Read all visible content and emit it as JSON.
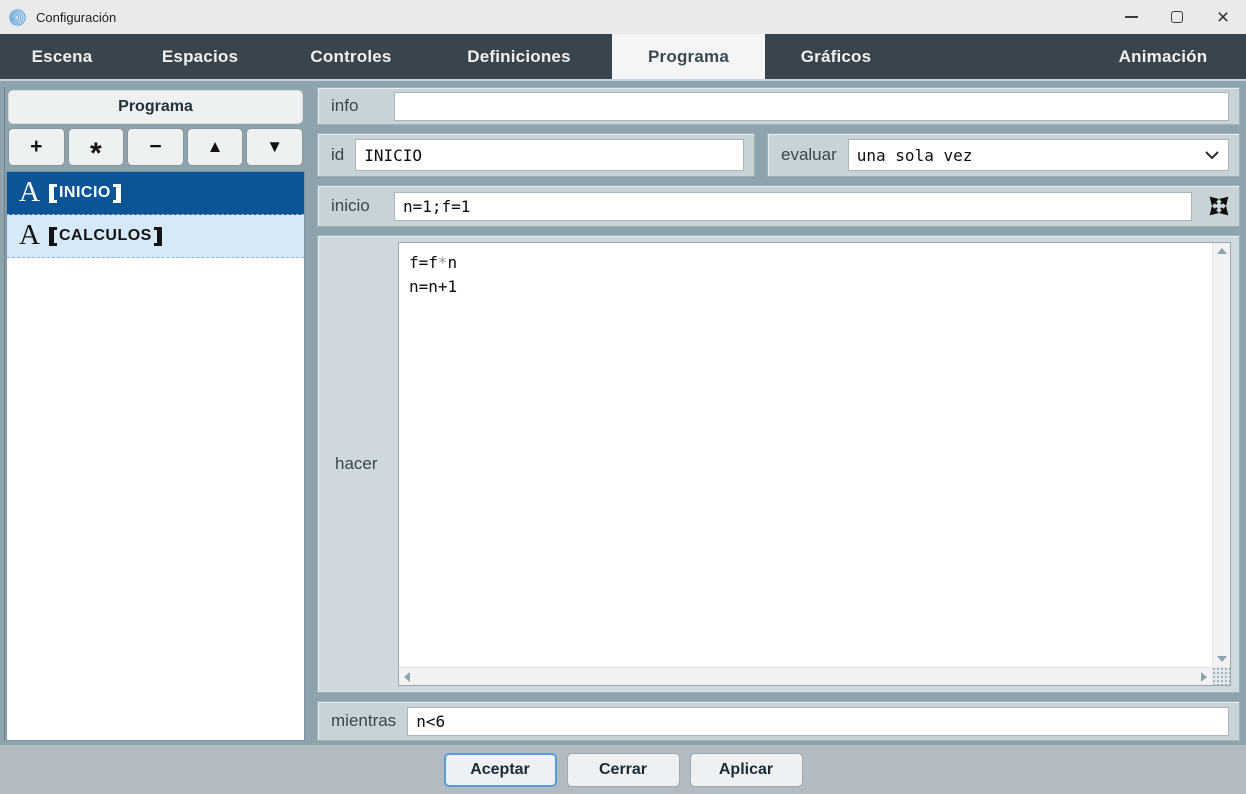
{
  "window": {
    "title": "Configuración",
    "icons": {
      "logo": "descartes-spiral",
      "minimize": "minimize-line",
      "maximize": "maximize-square",
      "close_glyph": "×"
    }
  },
  "tabs": [
    {
      "label": "Escena",
      "selected": false
    },
    {
      "label": "Espacios",
      "selected": false
    },
    {
      "label": "Controles",
      "selected": false
    },
    {
      "label": "Definiciones",
      "selected": false
    },
    {
      "label": "Programa",
      "selected": true
    },
    {
      "label": "Gráficos",
      "selected": false
    },
    {
      "label": "Animación",
      "selected": false
    }
  ],
  "sidebar": {
    "header": "Programa",
    "toolbar": {
      "add": "+",
      "asterisk": "*",
      "remove": "−",
      "up": "▲",
      "down": "▼"
    },
    "items": [
      {
        "glyph": "A",
        "label": "INICIO",
        "brackets": "【】",
        "selected": true
      },
      {
        "glyph": "A",
        "label": "CALCULOS",
        "brackets": "【】",
        "selected": false
      }
    ]
  },
  "form": {
    "info": {
      "label": "info",
      "value": ""
    },
    "id": {
      "label": "id",
      "value": "INICIO"
    },
    "evaluar": {
      "label": "evaluar",
      "value": "una sola vez"
    },
    "inicio": {
      "label": "inicio",
      "value": "n=1;f=1"
    },
    "hacer": {
      "label": "hacer",
      "code_line_1": {
        "before": "f=f",
        "operator": "*",
        "after": "n"
      },
      "code_line_2": "n=n+1"
    },
    "mientras": {
      "label": "mientras",
      "value": "n<6"
    }
  },
  "footer": {
    "accept": "Aceptar",
    "close": "Cerrar",
    "apply": "Aplicar"
  },
  "colors": {
    "tab_bar": "#3a444c",
    "main_bg": "#8fa3ad",
    "row_bg": "#c8d3d8",
    "selected_item": "#0b5596",
    "alt_item": "#d6e9f8",
    "accent_button_border": "#5b9bd5"
  }
}
